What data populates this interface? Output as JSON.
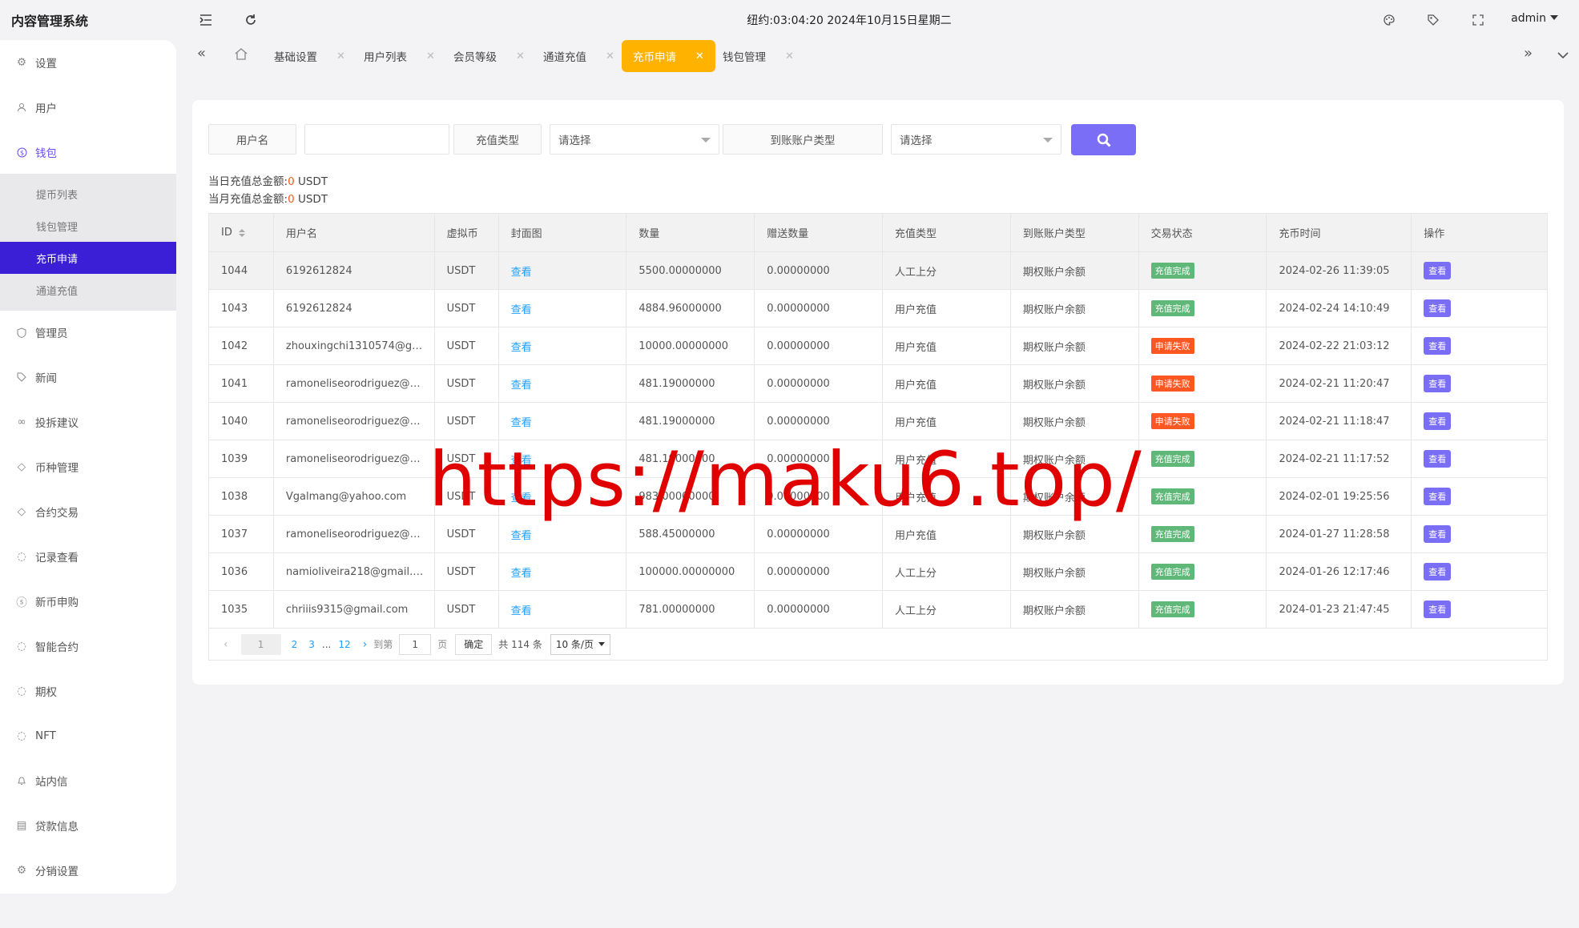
{
  "header": {
    "brand": "内容管理系统",
    "clock": "纽约:03:04:20 2024年10月15日星期二",
    "user": "admin"
  },
  "sidebar": {
    "items": [
      {
        "label": "设置",
        "icon": "gear-icon"
      },
      {
        "label": "用户",
        "icon": "user-icon"
      },
      {
        "label": "钱包",
        "icon": "coin-icon"
      },
      {
        "label": "管理员",
        "icon": "shield-icon"
      },
      {
        "label": "新闻",
        "icon": "tag-icon"
      },
      {
        "label": "投拆建议",
        "icon": "link-icon"
      },
      {
        "label": "币种管理",
        "icon": "diamond-icon"
      },
      {
        "label": "合约交易",
        "icon": "diamond-icon"
      },
      {
        "label": "记录查看",
        "icon": "circle-icon"
      },
      {
        "label": "新币申购",
        "icon": "coin-icon"
      },
      {
        "label": "智能合约",
        "icon": "circle-icon"
      },
      {
        "label": "期权",
        "icon": "circle-icon"
      },
      {
        "label": "NFT",
        "icon": "circle-icon"
      },
      {
        "label": "站内信",
        "icon": "bell-icon"
      },
      {
        "label": "贷款信息",
        "icon": "doc-icon"
      },
      {
        "label": "分销设置",
        "icon": "gear-icon"
      }
    ],
    "subitems": [
      "提币列表",
      "钱包管理",
      "充币申请",
      "通道充值"
    ]
  },
  "tabs": [
    "基础设置",
    "用户列表",
    "会员等级",
    "通道充值",
    "充币申请",
    "钱包管理"
  ],
  "filters": {
    "username_label": "用户名",
    "username_value": "",
    "recharge_type_label": "充值类型",
    "recharge_type_value": "请选择",
    "account_type_label": "到账账户类型",
    "account_type_value": "请选择"
  },
  "summary": {
    "today_label": "当日充值总金额:",
    "today_value": "0",
    "month_label": "当月充值总金额:",
    "month_value": "0",
    "unit": " USDT"
  },
  "table": {
    "columns": [
      "ID",
      "用户名",
      "虚拟币",
      "封面图",
      "数量",
      "赠送数量",
      "充值类型",
      "到账账户类型",
      "交易状态",
      "充币时间",
      "操作"
    ],
    "rows": [
      {
        "id": "1044",
        "user": "6192612824",
        "coin": "USDT",
        "cover": "查看",
        "amount": "5500.00000000",
        "bonus": "0.00000000",
        "type": "人工上分",
        "account": "期权账户余额",
        "status": "充值完成",
        "status_kind": "ok",
        "time": "2024-02-26 11:39:05",
        "action": "查看"
      },
      {
        "id": "1043",
        "user": "6192612824",
        "coin": "USDT",
        "cover": "查看",
        "amount": "4884.96000000",
        "bonus": "0.00000000",
        "type": "用户充值",
        "account": "期权账户余额",
        "status": "充值完成",
        "status_kind": "ok",
        "time": "2024-02-24 14:10:49",
        "action": "查看"
      },
      {
        "id": "1042",
        "user": "zhouxingchi1310574@gm...",
        "coin": "USDT",
        "cover": "查看",
        "amount": "10000.00000000",
        "bonus": "0.00000000",
        "type": "用户充值",
        "account": "期权账户余额",
        "status": "申请失败",
        "status_kind": "fail",
        "time": "2024-02-22 21:03:12",
        "action": "查看"
      },
      {
        "id": "1041",
        "user": "ramoneliseorodriguez@gm...",
        "coin": "USDT",
        "cover": "查看",
        "amount": "481.19000000",
        "bonus": "0.00000000",
        "type": "用户充值",
        "account": "期权账户余额",
        "status": "申请失败",
        "status_kind": "fail",
        "time": "2024-02-21 11:20:47",
        "action": "查看"
      },
      {
        "id": "1040",
        "user": "ramoneliseorodriguez@gm...",
        "coin": "USDT",
        "cover": "查看",
        "amount": "481.19000000",
        "bonus": "0.00000000",
        "type": "用户充值",
        "account": "期权账户余额",
        "status": "申请失败",
        "status_kind": "fail",
        "time": "2024-02-21 11:18:47",
        "action": "查看"
      },
      {
        "id": "1039",
        "user": "ramoneliseorodriguez@gm...",
        "coin": "USDT",
        "cover": "查看",
        "amount": "481.19000000",
        "bonus": "0.00000000",
        "type": "用户充值",
        "account": "期权账户余额",
        "status": "充值完成",
        "status_kind": "ok",
        "time": "2024-02-21 11:17:52",
        "action": "查看"
      },
      {
        "id": "1038",
        "user": "Vgalmang@yahoo.com",
        "coin": "USDT",
        "cover": "查看",
        "amount": "983.00000000",
        "bonus": "0.00000000",
        "type": "用户充值",
        "account": "期权账户余额",
        "status": "充值完成",
        "status_kind": "ok",
        "time": "2024-02-01 19:25:56",
        "action": "查看"
      },
      {
        "id": "1037",
        "user": "ramoneliseorodriguez@gm...",
        "coin": "USDT",
        "cover": "查看",
        "amount": "588.45000000",
        "bonus": "0.00000000",
        "type": "用户充值",
        "account": "期权账户余额",
        "status": "充值完成",
        "status_kind": "ok",
        "time": "2024-01-27 11:28:58",
        "action": "查看"
      },
      {
        "id": "1036",
        "user": "namioliveira218@gmail.com",
        "coin": "USDT",
        "cover": "查看",
        "amount": "100000.00000000",
        "bonus": "0.00000000",
        "type": "人工上分",
        "account": "期权账户余额",
        "status": "充值完成",
        "status_kind": "ok",
        "time": "2024-01-26 12:17:46",
        "action": "查看"
      },
      {
        "id": "1035",
        "user": "chriiis9315@gmail.com",
        "coin": "USDT",
        "cover": "查看",
        "amount": "781.00000000",
        "bonus": "0.00000000",
        "type": "人工上分",
        "account": "期权账户余额",
        "status": "充值完成",
        "status_kind": "ok",
        "time": "2024-01-23 21:47:45",
        "action": "查看"
      }
    ]
  },
  "pagination": {
    "current": "1",
    "pages": [
      "2",
      "3",
      "...",
      "12"
    ],
    "goto_label": "到第",
    "goto_value": "1",
    "page_unit": "页",
    "confirm": "确定",
    "total": "共 114 条",
    "page_size": "10 条/页"
  },
  "watermark": "https://maku6.top/"
}
